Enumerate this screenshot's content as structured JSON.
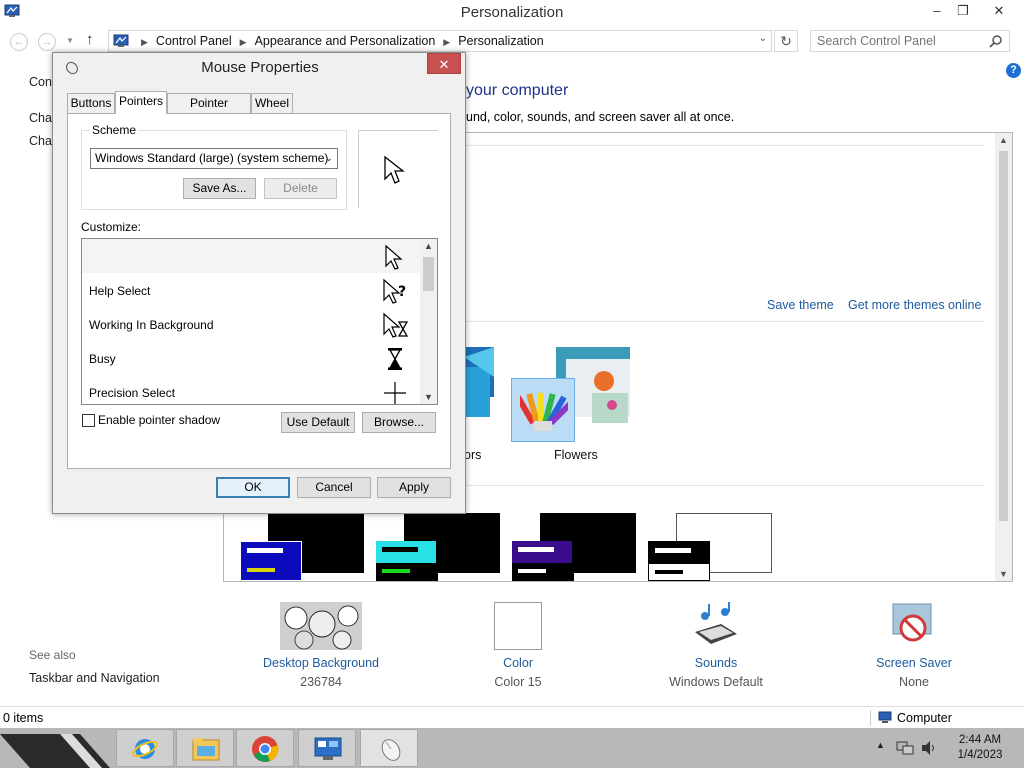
{
  "window": {
    "title": "Personalization",
    "minimize": "–",
    "maximize": "❐",
    "close": "✕"
  },
  "nav": {
    "back": "←",
    "forward": "→",
    "recent": "▼",
    "up": "↑",
    "breadcrumbs": [
      "Control Panel",
      "Appearance and Personalization",
      "Personalization"
    ],
    "refresh": "↻",
    "dropdown": "⌄",
    "search_placeholder": "Search Control Panel"
  },
  "help": "?",
  "left_pane": {
    "links": [
      "Cont",
      "Char",
      "Char"
    ]
  },
  "main": {
    "heading_tail": "your computer",
    "description_tail": "und, color, sounds, and screen saver all at once.",
    "save_theme": "Save theme",
    "get_more_themes": "Get more themes online",
    "theme_labels": [
      "ors",
      "Flowers"
    ]
  },
  "bottom": {
    "items": [
      {
        "name": "Desktop Background",
        "sub": "236784"
      },
      {
        "name": "Color",
        "sub": "Color 15"
      },
      {
        "name": "Sounds",
        "sub": "Windows Default"
      },
      {
        "name": "Screen Saver",
        "sub": "None"
      }
    ],
    "see_also": "See also",
    "taskbar_link": "Taskbar and Navigation"
  },
  "status": {
    "items": "0 items",
    "location": "Computer"
  },
  "clock": {
    "time": "2:44 AM",
    "date": "1/4/2023"
  },
  "dialog": {
    "title": "Mouse Properties",
    "close": "✕",
    "tabs": [
      "Buttons",
      "Pointers",
      "Pointer Options",
      "Wheel"
    ],
    "active_tab": "Pointers",
    "scheme_label": "Scheme",
    "scheme_value": "Windows Standard (large) (system scheme)",
    "save_as": "Save As...",
    "delete": "Delete",
    "customize_label": "Customize:",
    "pointer_rows": [
      {
        "label": "",
        "icon": "arrow-cursor-icon"
      },
      {
        "label": "Help Select",
        "icon": "help-cursor-icon"
      },
      {
        "label": "Working In Background",
        "icon": "working-cursor-icon"
      },
      {
        "label": "Busy",
        "icon": "busy-cursor-icon"
      },
      {
        "label": "Precision Select",
        "icon": "crosshair-cursor-icon"
      }
    ],
    "enable_shadow": "Enable pointer shadow",
    "enable_shadow_checked": false,
    "use_default": "Use Default",
    "browse": "Browse...",
    "ok": "OK",
    "cancel": "Cancel",
    "apply": "Apply"
  }
}
